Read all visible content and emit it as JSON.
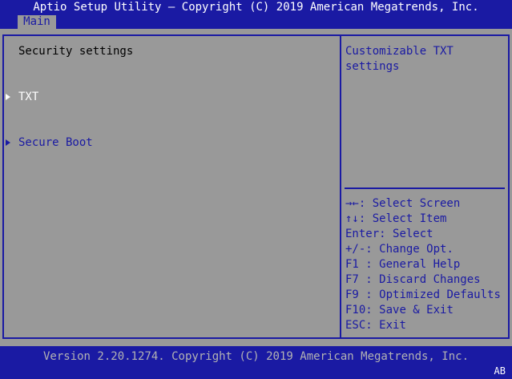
{
  "header": {
    "title": "Aptio Setup Utility – Copyright (C) 2019 American Megatrends, Inc.",
    "tabs": [
      {
        "label": "Main"
      }
    ]
  },
  "left_pane": {
    "heading": "Security settings",
    "items": [
      {
        "label": "TXT",
        "type": "submenu"
      },
      {
        "label": "Secure Boot",
        "type": "submenu"
      }
    ]
  },
  "help_pane": {
    "description_lines": [
      "Customizable TXT",
      "settings"
    ],
    "keys": [
      {
        "key": "→←",
        "sep": ": ",
        "action": "Select Screen"
      },
      {
        "key": "↑↓",
        "sep": ": ",
        "action": "Select Item"
      },
      {
        "key": "Enter",
        "sep": ": ",
        "action": "Select"
      },
      {
        "key": "+/-",
        "sep": ": ",
        "action": "Change Opt."
      },
      {
        "key": "F1 ",
        "sep": ": ",
        "action": "General Help"
      },
      {
        "key": "F7 ",
        "sep": ": ",
        "action": "Discard Changes"
      },
      {
        "key": "F9 ",
        "sep": ": ",
        "action": "Optimized Defaults"
      },
      {
        "key": "F10",
        "sep": ": ",
        "action": "Save & Exit"
      },
      {
        "key": "ESC",
        "sep": ": ",
        "action": "Exit"
      }
    ]
  },
  "footer": {
    "version": "Version 2.20.1274. Copyright (C) 2019 American Megatrends, Inc.",
    "badge": "AB"
  },
  "colors": {
    "background": "#1a1aa3",
    "panel": "#999999",
    "highlight_text": "#ffffff",
    "help_text": "#1a1aa3"
  }
}
